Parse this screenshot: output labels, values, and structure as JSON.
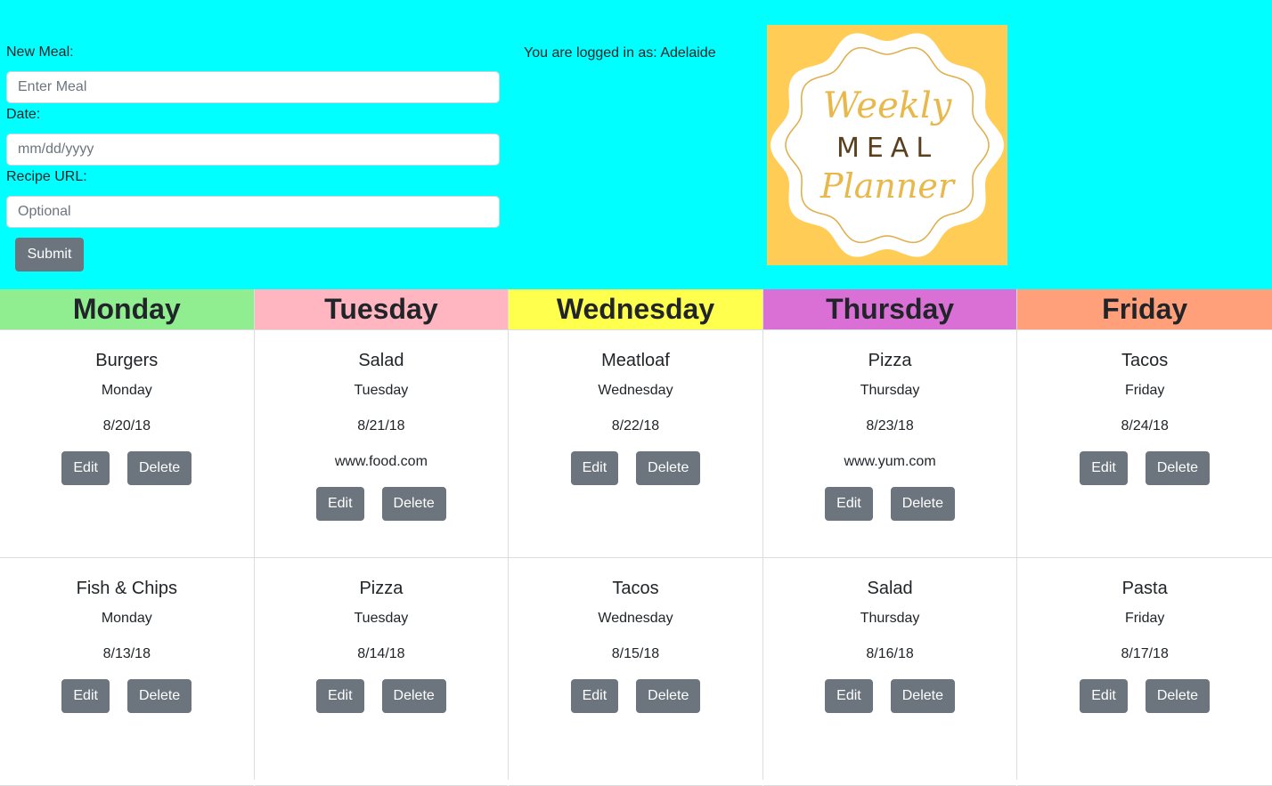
{
  "form": {
    "meal_label": "New Meal:",
    "meal_placeholder": "Enter Meal",
    "date_label": "Date:",
    "date_placeholder": "mm/dd/yyyy",
    "url_label": "Recipe URL:",
    "url_placeholder": "Optional",
    "submit_label": "Submit"
  },
  "user": {
    "logged_in_text": "You are logged in as: Adelaide"
  },
  "logo": {
    "line1": "Weekly",
    "line2": "MEAL",
    "line3": "Planner"
  },
  "colors": {
    "header_bg": "#00ffff",
    "monday": "#90ee90",
    "tuesday": "#ffb6c1",
    "wednesday": "#ffff4d",
    "thursday": "#da70d6",
    "friday": "#ffa07a",
    "logo_bg": "#ffcc55",
    "button": "#6c757d"
  },
  "edit_label": "Edit",
  "delete_label": "Delete",
  "days": [
    {
      "name": "Monday",
      "meals": [
        {
          "name": "Burgers",
          "day": "Monday",
          "date": "8/20/18",
          "url": ""
        },
        {
          "name": "Fish & Chips",
          "day": "Monday",
          "date": "8/13/18",
          "url": ""
        }
      ]
    },
    {
      "name": "Tuesday",
      "meals": [
        {
          "name": "Salad",
          "day": "Tuesday",
          "date": "8/21/18",
          "url": "www.food.com"
        },
        {
          "name": "Pizza",
          "day": "Tuesday",
          "date": "8/14/18",
          "url": ""
        }
      ]
    },
    {
      "name": "Wednesday",
      "meals": [
        {
          "name": "Meatloaf",
          "day": "Wednesday",
          "date": "8/22/18",
          "url": ""
        },
        {
          "name": "Tacos",
          "day": "Wednesday",
          "date": "8/15/18",
          "url": ""
        }
      ]
    },
    {
      "name": "Thursday",
      "meals": [
        {
          "name": "Pizza",
          "day": "Thursday",
          "date": "8/23/18",
          "url": "www.yum.com"
        },
        {
          "name": "Salad",
          "day": "Thursday",
          "date": "8/16/18",
          "url": ""
        }
      ]
    },
    {
      "name": "Friday",
      "meals": [
        {
          "name": "Tacos",
          "day": "Friday",
          "date": "8/24/18",
          "url": ""
        },
        {
          "name": "Pasta",
          "day": "Friday",
          "date": "8/17/18",
          "url": ""
        }
      ]
    }
  ]
}
